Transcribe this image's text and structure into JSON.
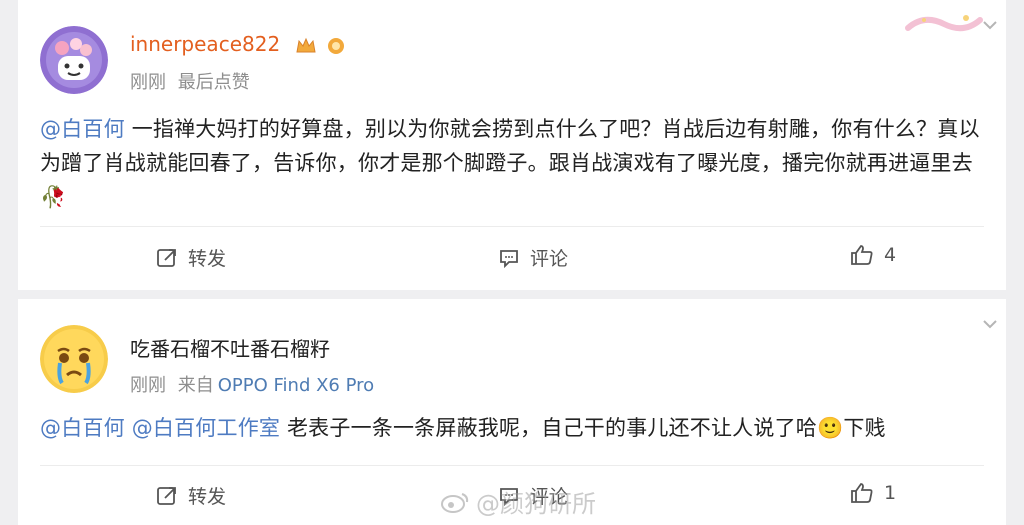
{
  "posts": [
    {
      "username": "innerpeace822",
      "meta": [
        "刚刚",
        "最后点赞"
      ],
      "mentions": [
        "@白百何"
      ],
      "text": " 一指禅大妈打的好算盘，别以为你就会捞到点什么了吧？肖战后边有射雕，你有什么？真以为蹭了肖战就能回春了，告诉你，你才是那个脚蹬子。跟肖战演戏有了曝光度，播完你就再进逼里去",
      "emoji": "🥀",
      "actions": {
        "repost": "转发",
        "comment": "评论",
        "likes": "4"
      }
    },
    {
      "username": "吃番石榴不吐番石榴籽",
      "meta": [
        "刚刚",
        "来自",
        "OPPO Find X6 Pro"
      ],
      "mentions": [
        "@白百何",
        "@白百何工作室"
      ],
      "text": " 老表子一条一条屏蔽我呢，自己干的事儿还不让人说了哈",
      "emoji": "🙂",
      "text_after": "下贱",
      "actions": {
        "repost": "转发",
        "comment": "评论",
        "likes": "1"
      }
    }
  ],
  "watermark": "@颜狗研所",
  "colors": {
    "accent_orange": "#e35f1f",
    "link_blue": "#4e7bc2",
    "device_blue": "#4f7cb3"
  }
}
